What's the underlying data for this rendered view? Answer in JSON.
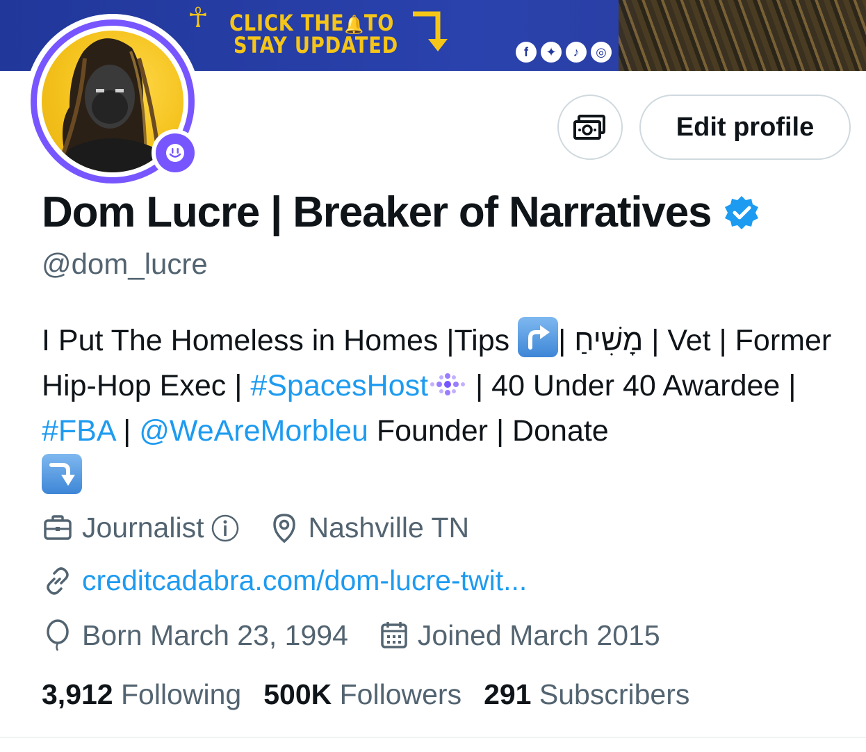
{
  "banner": {
    "line1": "CLICK THE",
    "line1_end": "TO",
    "line2": "STAY UPDATED",
    "social_icons": [
      "facebook-icon",
      "twitter-icon",
      "tiktok-icon",
      "instagram-icon"
    ],
    "accent_color": "#f5c518",
    "background_color": "#21379a"
  },
  "profile": {
    "display_name": "Dom Lucre | Breaker of Narratives",
    "handle": "@dom_lucre",
    "verified": true,
    "spaces_badge": "spaces-icon",
    "ring_color": "#7856ff"
  },
  "actions": {
    "subscribe_icon": "money-icon",
    "edit_profile": "Edit profile"
  },
  "bio": {
    "part1": "I Put The Homeless in Homes |Tips ",
    "part2": "| מָשִׁיחַ | Vet | Former Hip-Hop Exec | ",
    "hashtag_spaces": "#SpacesHost",
    "part3": " | 40 Under 40 Awardee | ",
    "hashtag_fba": "#FBA",
    "part4": " | ",
    "mention": "@WeAreMorbleu",
    "part5": " Founder | Donate",
    "emoji_up": "arrow-up-right-emoji",
    "emoji_down": "arrow-down-right-emoji"
  },
  "meta": {
    "profession": "Journalist",
    "location": "Nashville TN",
    "website": "creditcadabra.com/dom-lucre-twit...",
    "birthday": "Born March 23, 1994",
    "joined": "Joined March 2015"
  },
  "stats": {
    "following_count": "3,912",
    "following_label": "Following",
    "followers_count": "500K",
    "followers_label": "Followers",
    "subscribers_count": "291",
    "subscribers_label": "Subscribers"
  },
  "colors": {
    "link": "#1d9bf0",
    "secondary_text": "#536471",
    "verified": "#1d9bf0"
  }
}
